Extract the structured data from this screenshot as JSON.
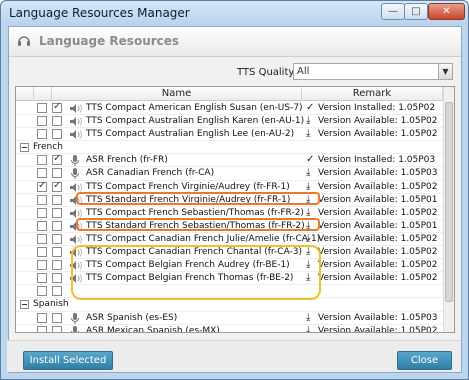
{
  "window": {
    "title": "Language Resources Manager",
    "min_glyph": "—",
    "max_glyph": "□",
    "close_glyph": "✕"
  },
  "header": {
    "title": "Language Resources"
  },
  "tts_quality": {
    "label": "TTS Quality",
    "value": "All",
    "arrow": "▼"
  },
  "grid": {
    "columns": {
      "name": "Name",
      "remark": "Remark"
    },
    "rows": [
      {
        "type": "item",
        "a": false,
        "b": true,
        "icon": "speaker",
        "name": "TTS Compact American English Susan (en-US-7)",
        "remark_icon": "check",
        "remark": "Version Installed: 1.05P02"
      },
      {
        "type": "item",
        "a": false,
        "b": false,
        "icon": "speaker",
        "name": "TTS Compact Australian English Karen (en-AU-1)",
        "remark_icon": "download",
        "remark": "Version Available: 1.05P02"
      },
      {
        "type": "item",
        "a": false,
        "b": false,
        "icon": "speaker",
        "name": "TTS Compact Australian English Lee (en-AU-2)",
        "remark_icon": "download",
        "remark": "Version Available: 1.05P02"
      },
      {
        "type": "group",
        "expanded": true,
        "name": "French"
      },
      {
        "type": "item",
        "a": false,
        "b": true,
        "icon": "mic",
        "name": "ASR French (fr-FR)",
        "remark_icon": "check",
        "remark": "Version Installed: 1.05P03"
      },
      {
        "type": "item",
        "a": false,
        "b": false,
        "icon": "mic",
        "name": "ASR Canadian French (fr-CA)",
        "remark_icon": "download",
        "remark": "Version Available: 1.05P03"
      },
      {
        "type": "item",
        "a": true,
        "b": true,
        "icon": "speaker",
        "name": "TTS Compact French Virginie/Audrey (fr-FR-1)",
        "remark_icon": "download",
        "remark": "Version Available: 1.05P02"
      },
      {
        "type": "item",
        "a": false,
        "b": false,
        "icon": "speaker",
        "name": "TTS Standard French Virginie/Audrey (fr-FR-1)",
        "remark_icon": "download",
        "remark": "Version Available: 1.05P01"
      },
      {
        "type": "item",
        "a": false,
        "b": false,
        "icon": "speaker",
        "name": "TTS Compact French Sebastien/Thomas (fr-FR-2)",
        "remark_icon": "download",
        "remark": "Version Available: 1.05P02"
      },
      {
        "type": "item",
        "a": false,
        "b": false,
        "icon": "speaker",
        "name": "TTS Standard French Sebastien/Thomas (fr-FR-2)",
        "remark_icon": "download",
        "remark": "Version Available: 1.05P01"
      },
      {
        "type": "item",
        "a": false,
        "b": false,
        "icon": "speaker",
        "name": "TTS Compact Canadian French Julie/Amelie (fr-CA-1)",
        "remark_icon": "download",
        "remark": "Version Available: 1.05P02"
      },
      {
        "type": "item",
        "a": false,
        "b": false,
        "icon": "speaker",
        "name": "TTS Compact Canadian French Chantal (fr-CA-3)",
        "remark_icon": "download",
        "remark": "Version Available: 1.05P02"
      },
      {
        "type": "item",
        "a": false,
        "b": false,
        "icon": "speaker",
        "name": "TTS Compact Belgian French Audrey (fr-BE-1)",
        "remark_icon": "download",
        "remark": "Version Available: 1.05P02"
      },
      {
        "type": "item",
        "a": false,
        "b": false,
        "icon": "speaker",
        "name": "TTS Compact Belgian French Thomas (fr-BE-2)",
        "remark_icon": "download",
        "remark": "Version Available: 1.05P02"
      },
      {
        "type": "item",
        "a": false,
        "b": false,
        "icon": "none",
        "name": "",
        "remark_icon": "none",
        "remark": ""
      },
      {
        "type": "group",
        "expanded": true,
        "name": "Spanish"
      },
      {
        "type": "item",
        "a": false,
        "b": false,
        "icon": "mic",
        "name": "ASR Spanish (es-ES)",
        "remark_icon": "download",
        "remark": "Version Available: 1.05P03"
      },
      {
        "type": "item",
        "a": false,
        "b": false,
        "icon": "mic",
        "name": "ASR Mexican Spanish (es-MX)",
        "remark_icon": "download",
        "remark": "Version Available: 1.05P02"
      }
    ]
  },
  "buttons": {
    "install": "Install Selected",
    "close": "Close"
  },
  "colors": {
    "orange_highlight": "#e97a2b",
    "yellow_highlight": "#f0c22a",
    "button": "#3a8db5"
  }
}
